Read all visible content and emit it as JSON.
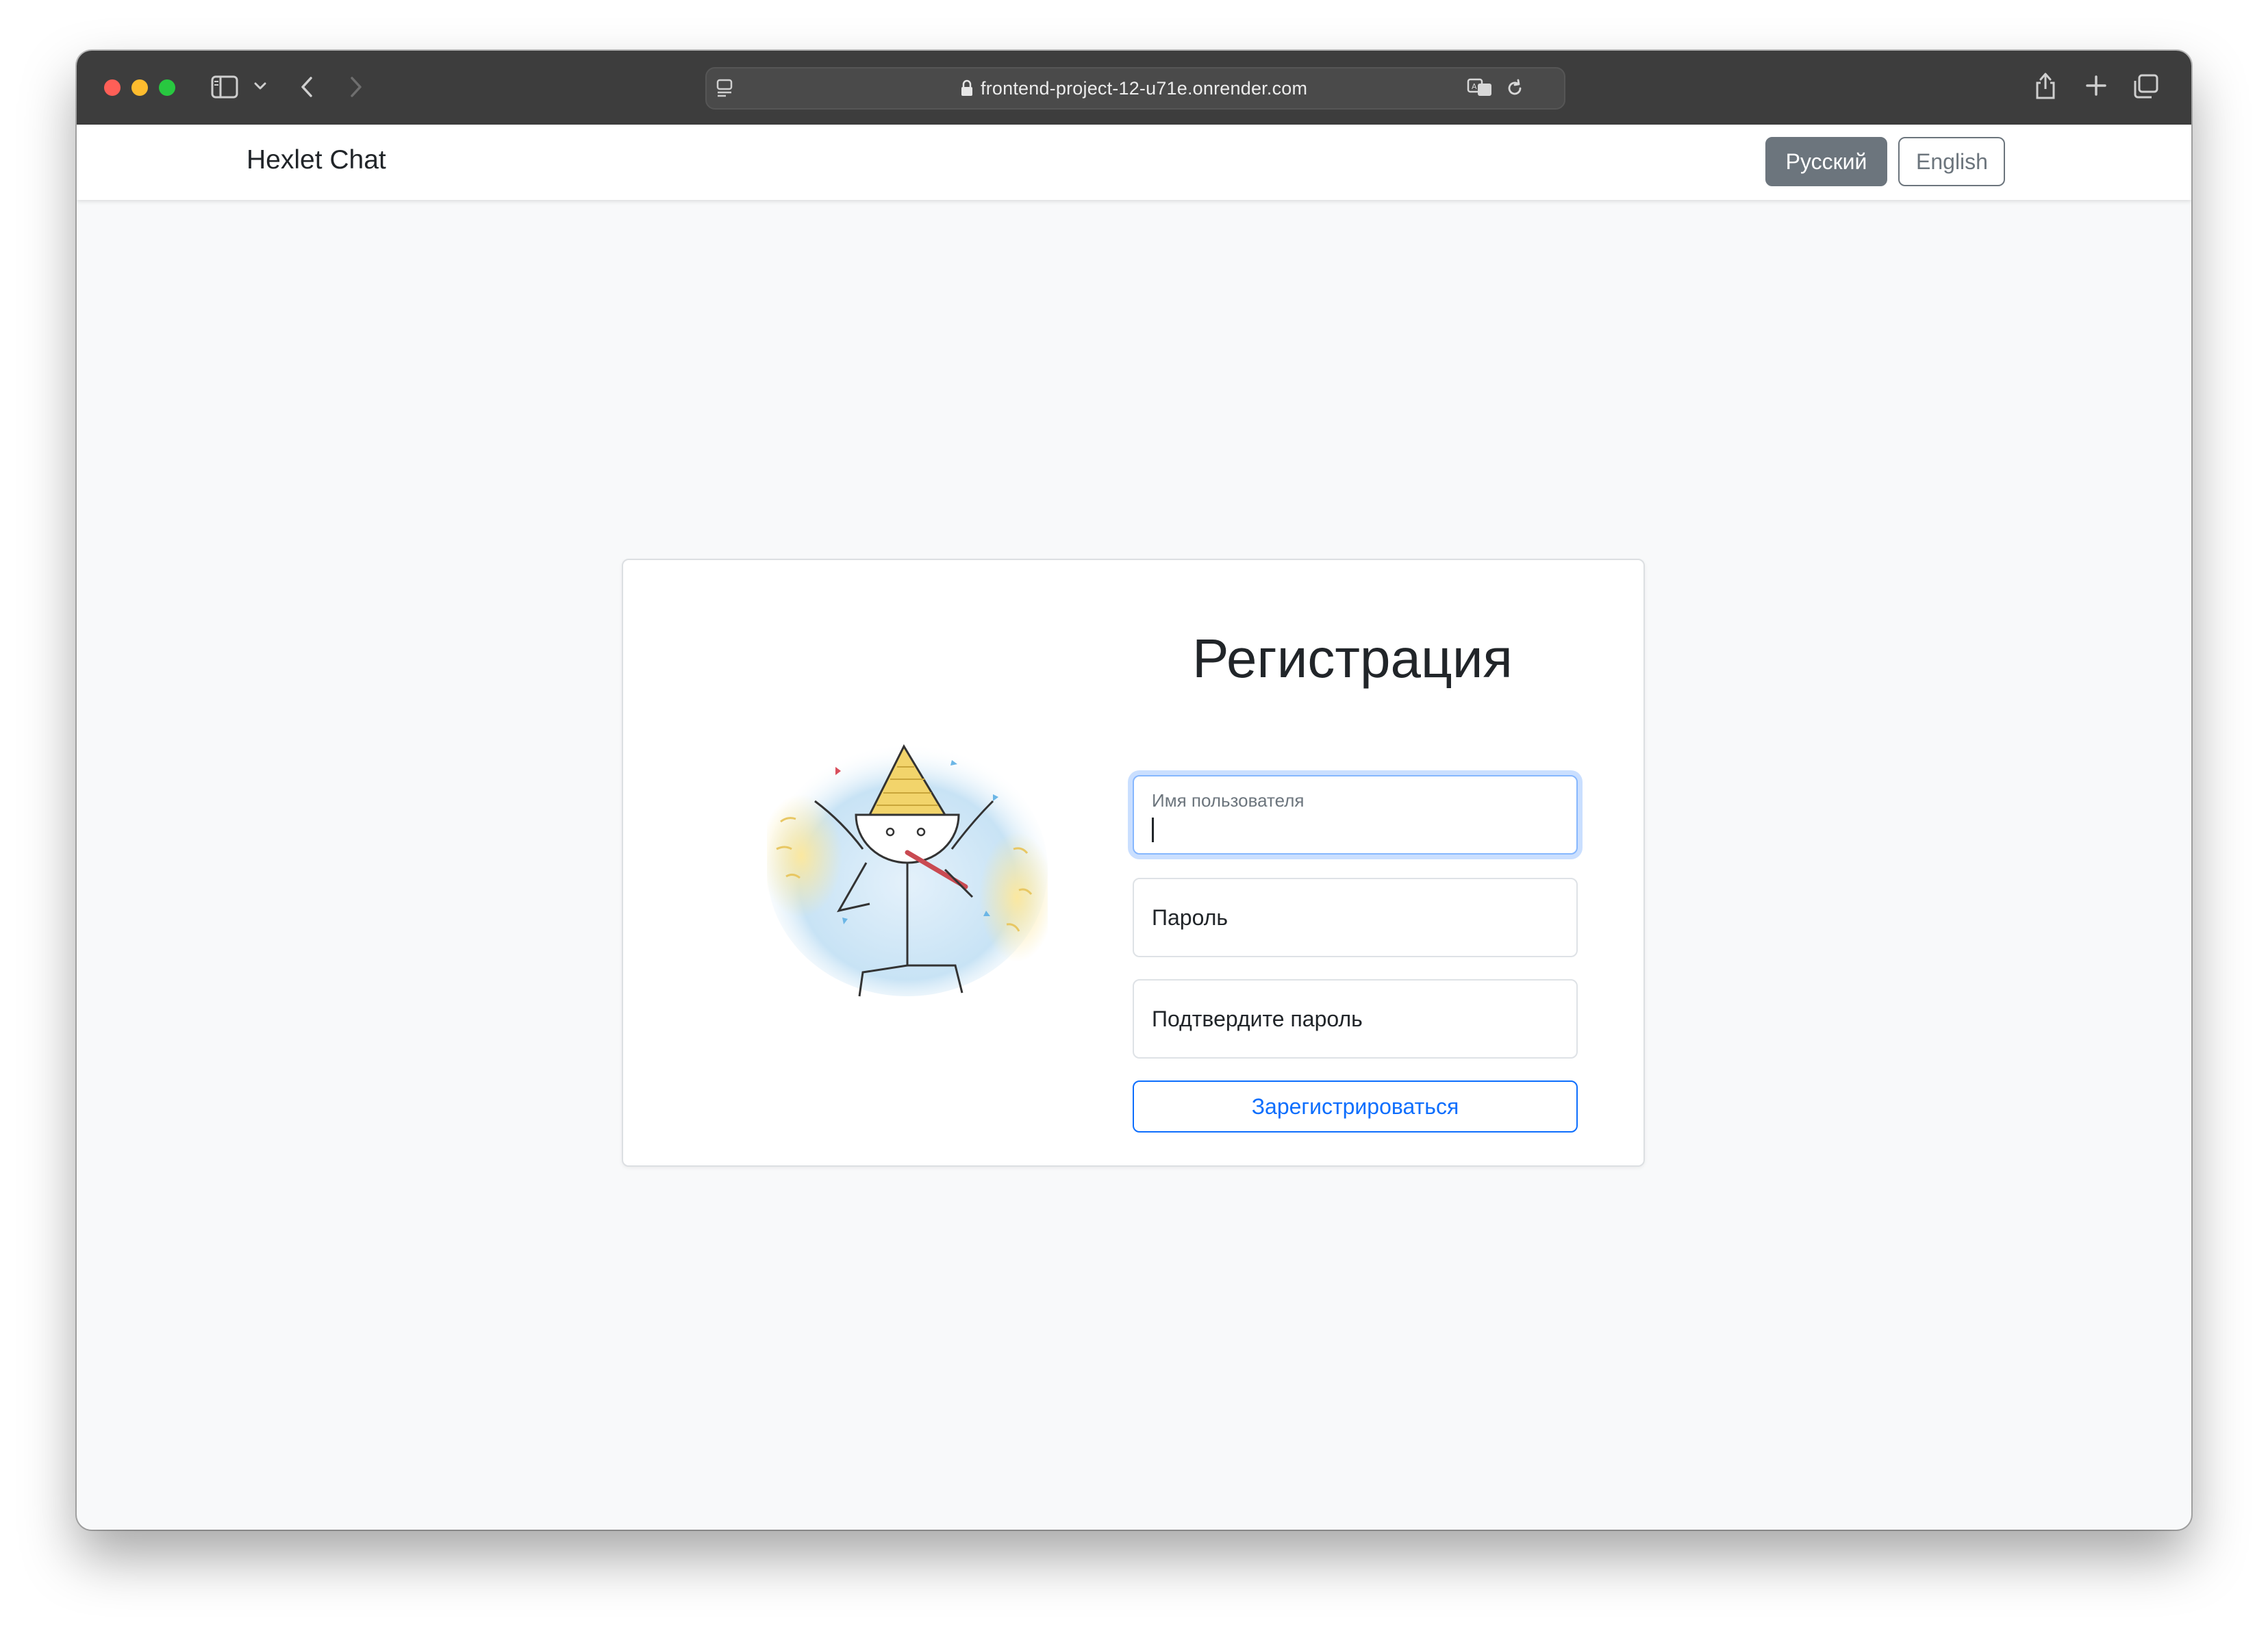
{
  "browser": {
    "url": "frontend-project-12-u71e.onrender.com"
  },
  "navbar": {
    "brand": "Hexlet Chat",
    "lang_ru": "Русский",
    "lang_en": "English"
  },
  "form": {
    "title": "Регистрация",
    "username_label": "Имя пользователя",
    "username_value": "",
    "password_placeholder": "Пароль",
    "confirm_placeholder": "Подтвердите пароль",
    "submit_label": "Зарегистрироваться"
  },
  "icons": [
    "sidebar-icon",
    "chevron-down-icon",
    "back-icon",
    "forward-icon",
    "page-menu-icon",
    "lock-icon",
    "translate-icon",
    "reload-icon",
    "share-icon",
    "plus-icon",
    "tabs-icon"
  ],
  "colors": {
    "active_lang": "#6c757d",
    "primary": "#0d6efd",
    "page_bg": "#f8f9fa",
    "toolbar": "#3d3d3d"
  }
}
